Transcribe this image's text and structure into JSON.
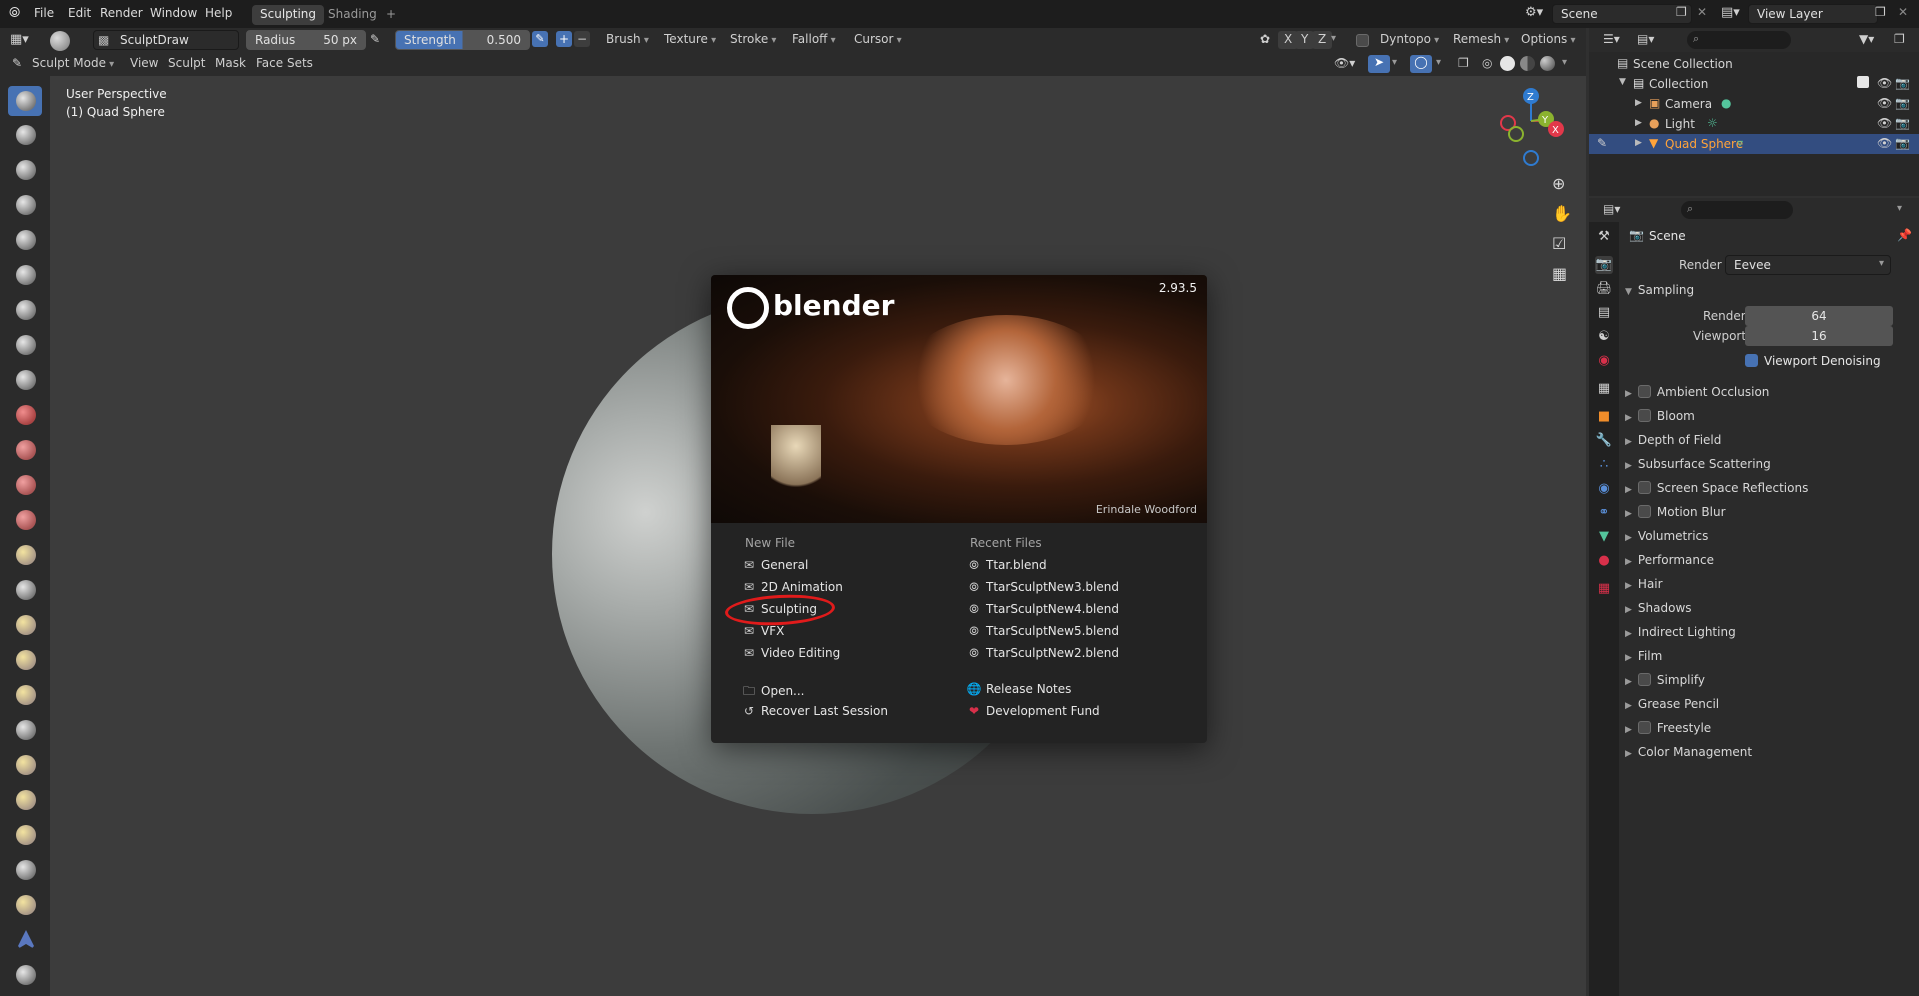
{
  "topbar": {
    "menus": [
      "File",
      "Edit",
      "Render",
      "Window",
      "Help"
    ],
    "workspaces": {
      "active": "Sculpting",
      "inactive": "Shading",
      "add": "+"
    },
    "scene_field": "Scene",
    "view_layer_field": "View Layer"
  },
  "tool_header": {
    "brush_name": "SculptDraw",
    "radius_label": "Radius",
    "radius_value": "50 px",
    "strength_label": "Strength",
    "strength_value": "0.500",
    "menus": [
      "Brush",
      "Texture",
      "Stroke",
      "Falloff",
      "Cursor"
    ],
    "axes": [
      "X",
      "Y",
      "Z"
    ],
    "dyntopo_label": "Dyntopo",
    "remesh_label": "Remesh",
    "options_label": "Options"
  },
  "mode_header": {
    "mode": "Sculpt Mode",
    "menus": [
      "View",
      "Sculpt",
      "Mask",
      "Face Sets"
    ]
  },
  "viewport": {
    "perspective": "User Perspective",
    "object": "(1) Quad Sphere",
    "gizmo_axes": {
      "z": "Z",
      "y": "Y",
      "x": "X"
    }
  },
  "splash": {
    "version": "2.93.5",
    "logo_text": "blender",
    "artist_credit": "Erindale Woodford",
    "new_file_title": "New File",
    "new_file_items": [
      "General",
      "2D Animation",
      "Sculpting",
      "VFX",
      "Video Editing"
    ],
    "other_items": [
      "Open...",
      "Recover Last Session"
    ],
    "recent_title": "Recent Files",
    "recent_files": [
      "Ttar.blend",
      "TtarSculptNew3.blend",
      "TtarSculptNew4.blend",
      "TtarSculptNew5.blend",
      "TtarSculptNew2.blend"
    ],
    "links": [
      "Release Notes",
      "Development Fund"
    ],
    "highlight_color": "#e01b1b"
  },
  "outliner": {
    "root": "Scene Collection",
    "collection": "Collection",
    "objects": [
      "Camera",
      "Light",
      "Quad Sphere"
    ],
    "selected": "Quad Sphere",
    "selected_color": "#ffa33a"
  },
  "properties": {
    "context": "Scene",
    "render_engine_label": "Render Engine",
    "render_engine_value": "Eevee",
    "sampling_title": "Sampling",
    "render_label": "Render",
    "render_value": "64",
    "viewport_label": "Viewport",
    "viewport_value": "16",
    "viewport_denoising": "Viewport Denoising",
    "sections": [
      {
        "label": "Ambient Occlusion",
        "checkbox": true
      },
      {
        "label": "Bloom",
        "checkbox": true
      },
      {
        "label": "Depth of Field",
        "checkbox": false
      },
      {
        "label": "Subsurface Scattering",
        "checkbox": false
      },
      {
        "label": "Screen Space Reflections",
        "checkbox": true
      },
      {
        "label": "Motion Blur",
        "checkbox": true
      },
      {
        "label": "Volumetrics",
        "checkbox": false
      },
      {
        "label": "Performance",
        "checkbox": false
      },
      {
        "label": "Hair",
        "checkbox": false
      },
      {
        "label": "Shadows",
        "checkbox": false
      },
      {
        "label": "Indirect Lighting",
        "checkbox": false
      },
      {
        "label": "Film",
        "checkbox": false
      },
      {
        "label": "Simplify",
        "checkbox": true
      },
      {
        "label": "Grease Pencil",
        "checkbox": false
      },
      {
        "label": "Freestyle",
        "checkbox": true
      },
      {
        "label": "Color Management",
        "checkbox": false
      }
    ]
  }
}
